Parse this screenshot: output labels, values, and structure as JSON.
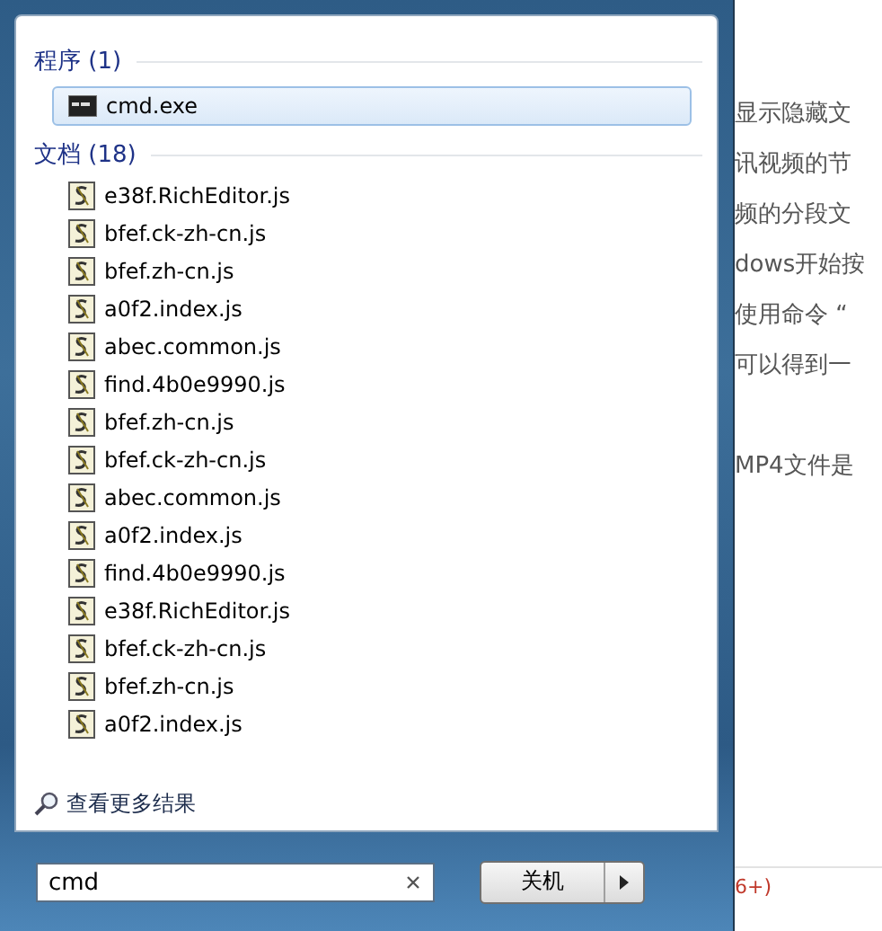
{
  "start_menu": {
    "groups": [
      {
        "header": "程序 (1)",
        "items": [
          {
            "label": "cmd.exe",
            "kind": "program",
            "selected": true
          }
        ]
      },
      {
        "header": "文档 (18)",
        "items": [
          {
            "label": "e38f.RichEditor.js",
            "kind": "script",
            "selected": false
          },
          {
            "label": "bfef.ck-zh-cn.js",
            "kind": "script",
            "selected": false
          },
          {
            "label": "bfef.zh-cn.js",
            "kind": "script",
            "selected": false
          },
          {
            "label": "a0f2.index.js",
            "kind": "script",
            "selected": false
          },
          {
            "label": "abec.common.js",
            "kind": "script",
            "selected": false
          },
          {
            "label": "find.4b0e9990.js",
            "kind": "script",
            "selected": false
          },
          {
            "label": "bfef.zh-cn.js",
            "kind": "script",
            "selected": false
          },
          {
            "label": "bfef.ck-zh-cn.js",
            "kind": "script",
            "selected": false
          },
          {
            "label": "abec.common.js",
            "kind": "script",
            "selected": false
          },
          {
            "label": "a0f2.index.js",
            "kind": "script",
            "selected": false
          },
          {
            "label": "find.4b0e9990.js",
            "kind": "script",
            "selected": false
          },
          {
            "label": "e38f.RichEditor.js",
            "kind": "script",
            "selected": false
          },
          {
            "label": "bfef.ck-zh-cn.js",
            "kind": "script",
            "selected": false
          },
          {
            "label": "bfef.zh-cn.js",
            "kind": "script",
            "selected": false
          },
          {
            "label": "a0f2.index.js",
            "kind": "script",
            "selected": false
          }
        ]
      }
    ],
    "more_results": "查看更多结果",
    "search": {
      "value": "cmd"
    },
    "shutdown_button": "关机"
  },
  "background_page": {
    "lines": [
      "显示隐藏文",
      "讯视频的节",
      "频的分段文",
      "dows开始按",
      "使用命令 “",
      "可以得到一",
      "MP4文件是"
    ],
    "footer_note": "6+)"
  }
}
